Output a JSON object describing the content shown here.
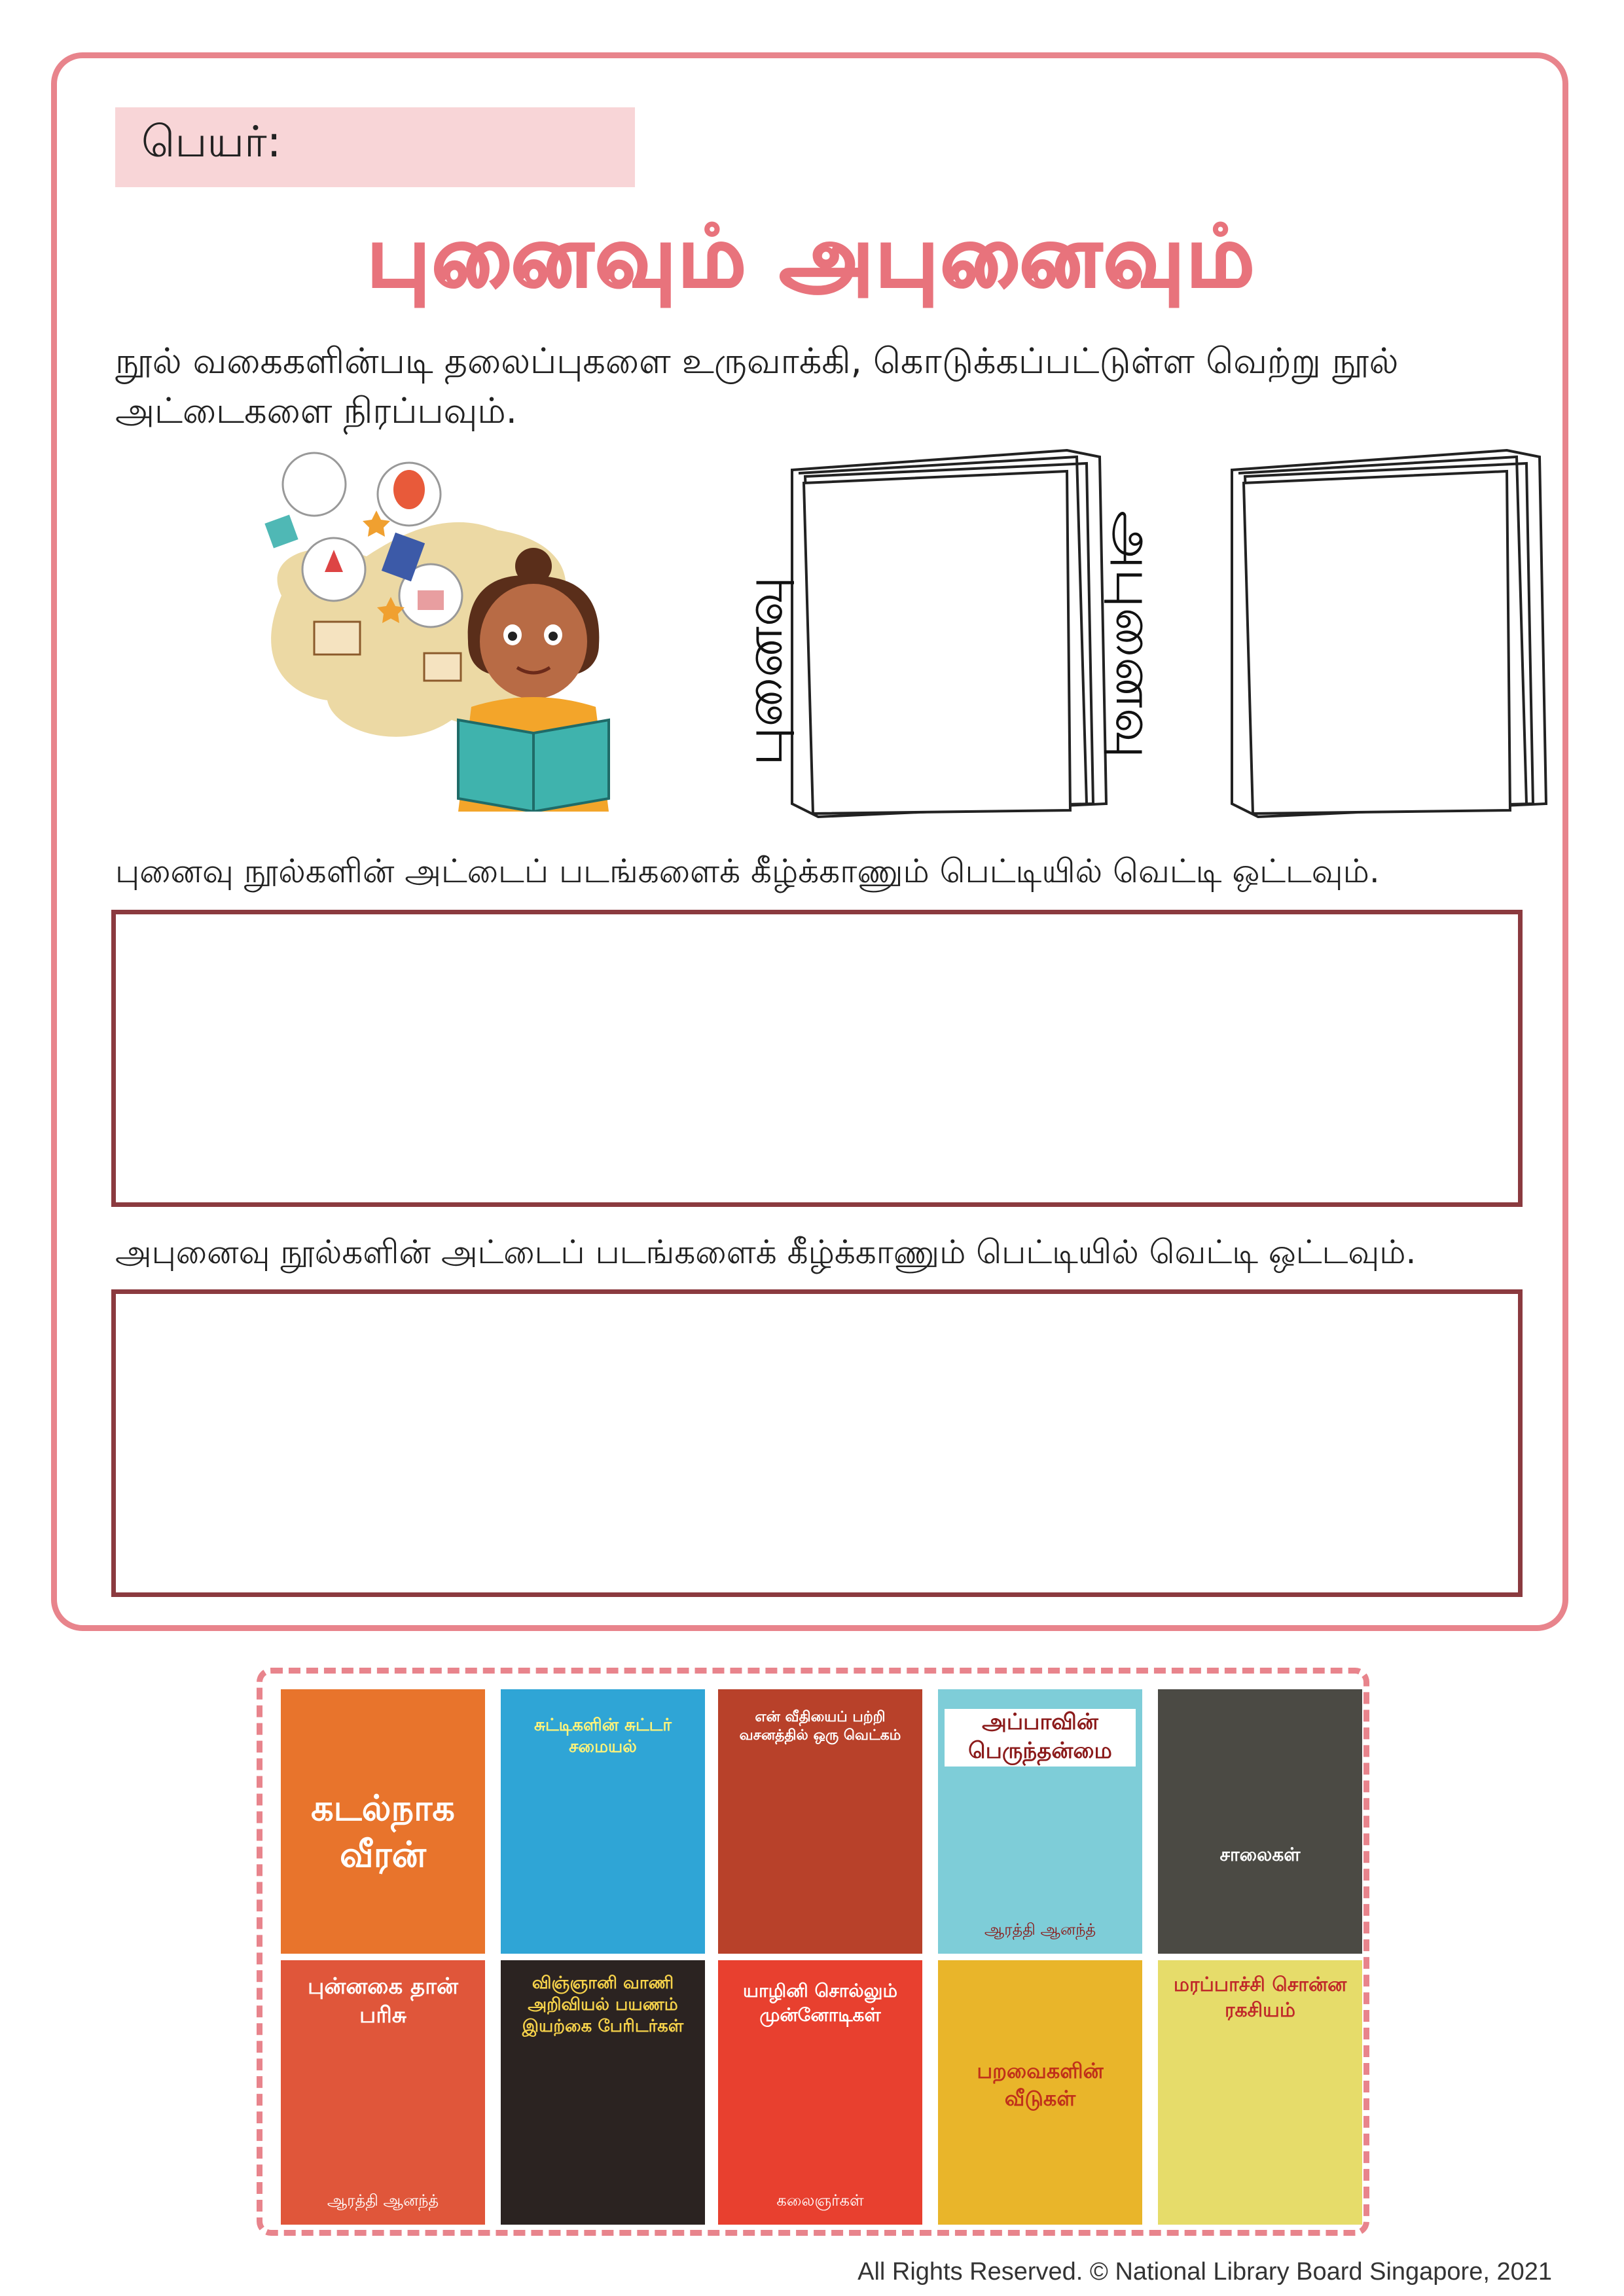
{
  "header": {
    "name_label": "பெயர்:"
  },
  "title": "புனைவும் அபுனைவும்",
  "instruction": "நூல் வகைகளின்படி தலைப்புகளை உருவாக்கி, கொடுக்கப்பட்டுள்ள வெற்று நூல் அட்டைகளை நிரப்பவும்.",
  "books": {
    "left_label": "புனைவு",
    "right_label": "அபுனைவு"
  },
  "sections": {
    "fiction_text": "புனைவு நூல்களின் அட்டைப் படங்களைக் கீழ்க்காணும் பெட்டியில்  வெட்டி ஒட்டவும்.",
    "nonfiction_text": "அபுனைவு நூல்களின் அட்டைப் படங்களைக் கீழ்க்காணும் பெட்டியில்  வெட்டி ஒட்டவும்."
  },
  "covers": [
    {
      "title": "கடல்நாக வீரன்",
      "author": "",
      "bg": "#e8742c"
    },
    {
      "title": "சுட்டிகளின் சுட்டர் சமையல்",
      "author": "",
      "bg": "#2fa5d6"
    },
    {
      "title": "என் வீதியைப் பற்றி வசனத்தில் ஒரு வெட்கம்",
      "author": "",
      "bg": "#b8412a"
    },
    {
      "title": "அப்பாவின் பெருந்தன்மை",
      "author": "ஆரத்தி ஆனந்த்",
      "bg": "#7ecdd8"
    },
    {
      "title": "சாலைகள்",
      "author": "",
      "bg": "#4b4a44"
    },
    {
      "title": "புன்னகை தான் பரிசு",
      "author": "ஆரத்தி ஆனந்த்",
      "bg": "#e0563a"
    },
    {
      "title": "விஞ்ஞானி வாணி அறிவியல் பயணம் இயற்கை பேரிடர்கள்",
      "author": "",
      "bg": "#2b2321"
    },
    {
      "title": "யாழினி சொல்லும் முன்னோடிகள்",
      "author": "கலைஞர்கள்",
      "bg": "#e8402f"
    },
    {
      "title": "பறவைகளின் வீடுகள்",
      "author": "",
      "bg": "#e9b52a"
    },
    {
      "title": "மரப்பாச்சி சொன்ன ரகசியம்",
      "author": "",
      "bg": "#e6dc6a"
    }
  ],
  "footer": "All Rights Reserved. © National Library Board Singapore, 2021",
  "colors": {
    "frame": "#e8848c",
    "title_stroke": "#e8737c",
    "paste_border": "#8b3a3f",
    "name_box": "#f8d5d7"
  }
}
